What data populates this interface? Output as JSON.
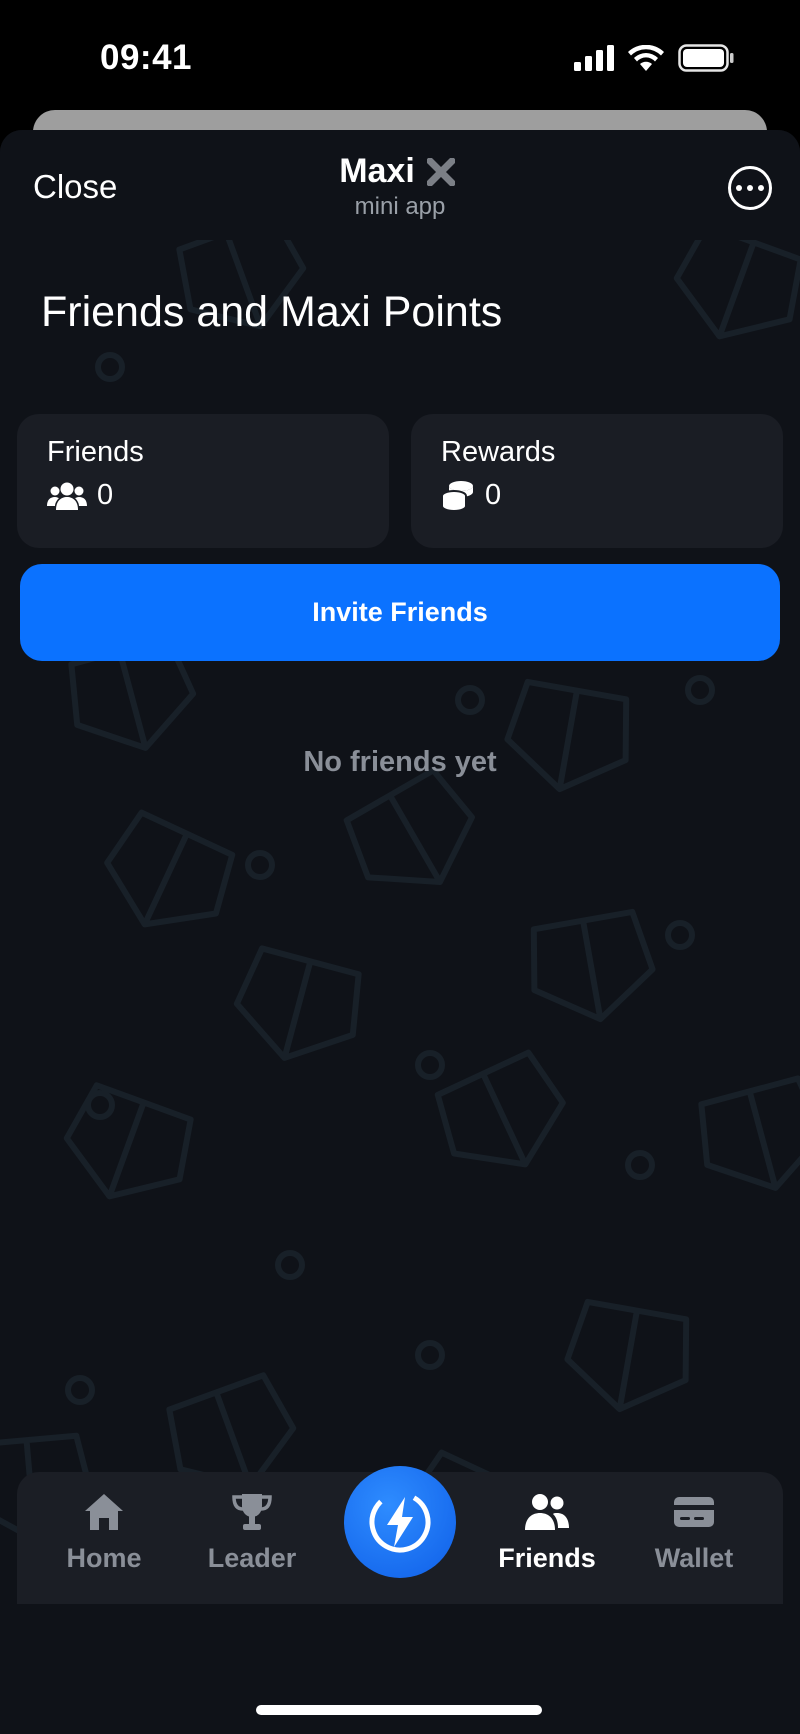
{
  "status_bar": {
    "time": "09:41"
  },
  "header": {
    "close_label": "Close",
    "title": "Maxi",
    "subtitle": "mini app"
  },
  "page": {
    "title": "Friends and Maxi Points",
    "friends_card": {
      "label": "Friends",
      "value": "0",
      "icon": "users-icon"
    },
    "rewards_card": {
      "label": "Rewards",
      "value": "0",
      "icon": "coins-icon"
    },
    "invite_label": "Invite Friends",
    "empty_text": "No friends yet"
  },
  "tabbar": {
    "tabs": [
      {
        "label": "Home",
        "icon": "home-icon",
        "active": false
      },
      {
        "label": "Leader",
        "icon": "trophy-icon",
        "active": false
      },
      {
        "label": "Friends",
        "icon": "users-icon",
        "active": true
      },
      {
        "label": "Wallet",
        "icon": "wallet-icon",
        "active": false
      }
    ],
    "center_icon": "lightning-icon"
  },
  "colors": {
    "accent": "#0b72ff",
    "background": "#0f1218",
    "card": "#1a1d24",
    "muted_text": "#8a8f98"
  }
}
